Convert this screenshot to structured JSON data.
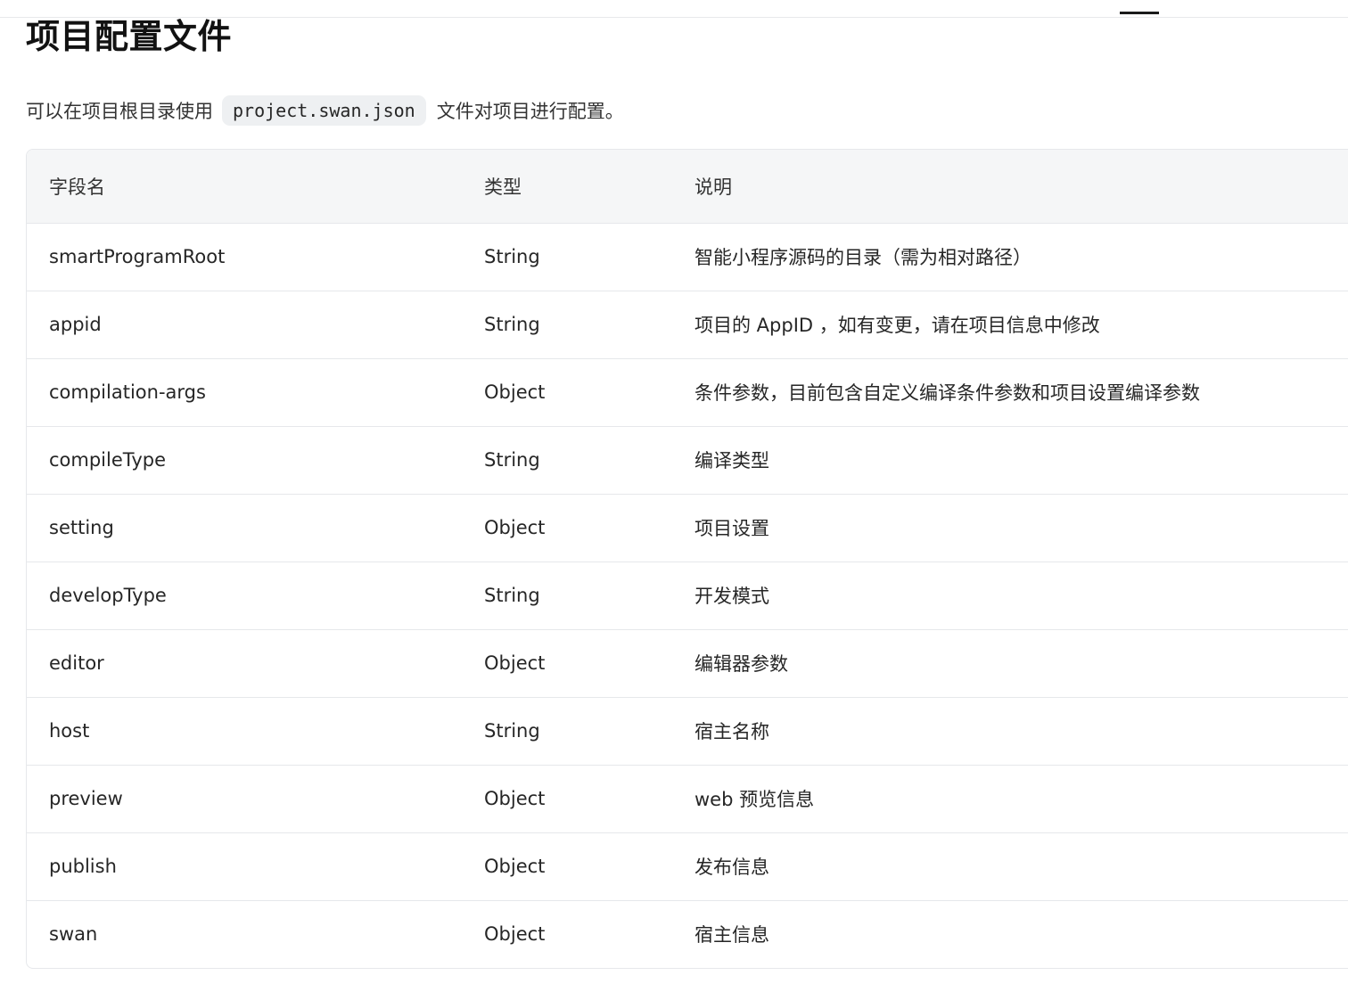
{
  "page": {
    "title": "项目配置文件",
    "intro_before": "可以在项目根目录使用",
    "intro_code": "project.swan.json",
    "intro_after": "文件对项目进行配置。"
  },
  "table": {
    "headers": [
      "字段名",
      "类型",
      "说明"
    ],
    "rows": [
      {
        "field": "smartProgramRoot",
        "type": "String",
        "desc": "智能小程序源码的目录（需为相对路径）"
      },
      {
        "field": "appid",
        "type": "String",
        "desc": "项目的 AppID ，如有变更，请在项目信息中修改"
      },
      {
        "field": "compilation-args",
        "type": "Object",
        "desc": "条件参数，目前包含自定义编译条件参数和项目设置编译参数"
      },
      {
        "field": "compileType",
        "type": "String",
        "desc": "编译类型"
      },
      {
        "field": "setting",
        "type": "Object",
        "desc": "项目设置"
      },
      {
        "field": "developType",
        "type": "String",
        "desc": "开发模式"
      },
      {
        "field": "editor",
        "type": "Object",
        "desc": "编辑器参数"
      },
      {
        "field": "host",
        "type": "String",
        "desc": "宿主名称"
      },
      {
        "field": "preview",
        "type": "Object",
        "desc": "web 预览信息"
      },
      {
        "field": "publish",
        "type": "Object",
        "desc": "发布信息"
      },
      {
        "field": "swan",
        "type": "Object",
        "desc": "宿主信息"
      }
    ]
  },
  "colors": {
    "header_bg": "#f5f6f7",
    "border": "#e6e8eb",
    "code_bg": "#eef0f2"
  }
}
